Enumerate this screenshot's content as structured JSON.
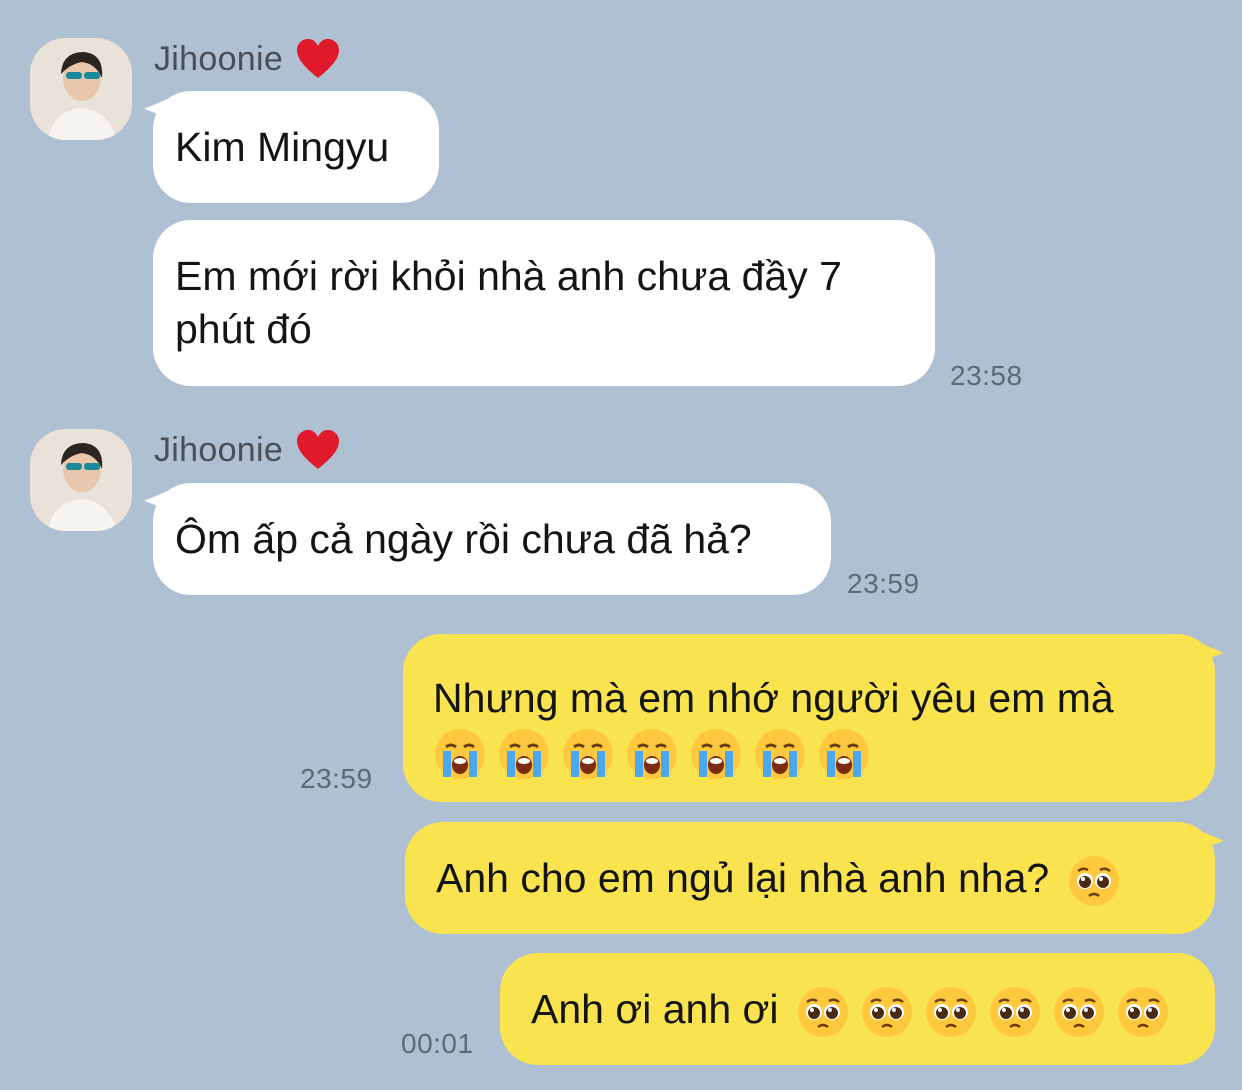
{
  "contact": {
    "name": "Jihoonie",
    "name_icon": "red-heart-icon"
  },
  "messages": [
    {
      "text": "Kim Mingyu"
    },
    {
      "text": "Em mới rời khỏi nhà anh chưa đầy 7",
      "text2": "phút đó",
      "time": "23:58"
    },
    {
      "text": "Ôm ấp cả ngày rồi chưa đã hả?",
      "time": "23:59"
    },
    {
      "text": "Nhưng mà em nhớ người yêu em mà",
      "emoji": "loudly-crying-face",
      "emoji_count": 7,
      "time": "23:59"
    },
    {
      "text": "Anh cho em ngủ lại nhà anh nha?",
      "emoji": "pleading-face",
      "emoji_count": 1
    },
    {
      "text": "Anh ơi anh ơi",
      "emoji": "pleading-face",
      "emoji_count": 6,
      "time": "00:01"
    }
  ],
  "colors": {
    "background": "#aec0d2",
    "incoming_bubble": "#ffffff",
    "outgoing_bubble": "#f9e44f",
    "time": "#5f6a77"
  }
}
